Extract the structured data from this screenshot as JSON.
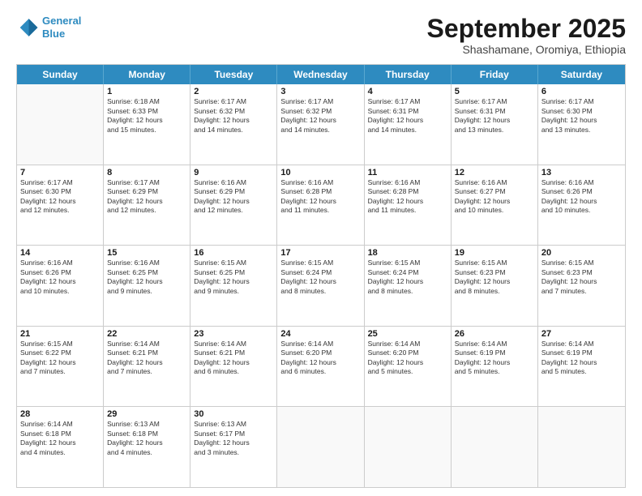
{
  "header": {
    "logo_line1": "General",
    "logo_line2": "Blue",
    "month_title": "September 2025",
    "subtitle": "Shashamane, Oromiya, Ethiopia"
  },
  "day_headers": [
    "Sunday",
    "Monday",
    "Tuesday",
    "Wednesday",
    "Thursday",
    "Friday",
    "Saturday"
  ],
  "weeks": [
    [
      {
        "num": "",
        "info": ""
      },
      {
        "num": "1",
        "info": "Sunrise: 6:18 AM\nSunset: 6:33 PM\nDaylight: 12 hours\nand 15 minutes."
      },
      {
        "num": "2",
        "info": "Sunrise: 6:17 AM\nSunset: 6:32 PM\nDaylight: 12 hours\nand 14 minutes."
      },
      {
        "num": "3",
        "info": "Sunrise: 6:17 AM\nSunset: 6:32 PM\nDaylight: 12 hours\nand 14 minutes."
      },
      {
        "num": "4",
        "info": "Sunrise: 6:17 AM\nSunset: 6:31 PM\nDaylight: 12 hours\nand 14 minutes."
      },
      {
        "num": "5",
        "info": "Sunrise: 6:17 AM\nSunset: 6:31 PM\nDaylight: 12 hours\nand 13 minutes."
      },
      {
        "num": "6",
        "info": "Sunrise: 6:17 AM\nSunset: 6:30 PM\nDaylight: 12 hours\nand 13 minutes."
      }
    ],
    [
      {
        "num": "7",
        "info": "Sunrise: 6:17 AM\nSunset: 6:30 PM\nDaylight: 12 hours\nand 12 minutes."
      },
      {
        "num": "8",
        "info": "Sunrise: 6:17 AM\nSunset: 6:29 PM\nDaylight: 12 hours\nand 12 minutes."
      },
      {
        "num": "9",
        "info": "Sunrise: 6:16 AM\nSunset: 6:29 PM\nDaylight: 12 hours\nand 12 minutes."
      },
      {
        "num": "10",
        "info": "Sunrise: 6:16 AM\nSunset: 6:28 PM\nDaylight: 12 hours\nand 11 minutes."
      },
      {
        "num": "11",
        "info": "Sunrise: 6:16 AM\nSunset: 6:28 PM\nDaylight: 12 hours\nand 11 minutes."
      },
      {
        "num": "12",
        "info": "Sunrise: 6:16 AM\nSunset: 6:27 PM\nDaylight: 12 hours\nand 10 minutes."
      },
      {
        "num": "13",
        "info": "Sunrise: 6:16 AM\nSunset: 6:26 PM\nDaylight: 12 hours\nand 10 minutes."
      }
    ],
    [
      {
        "num": "14",
        "info": "Sunrise: 6:16 AM\nSunset: 6:26 PM\nDaylight: 12 hours\nand 10 minutes."
      },
      {
        "num": "15",
        "info": "Sunrise: 6:16 AM\nSunset: 6:25 PM\nDaylight: 12 hours\nand 9 minutes."
      },
      {
        "num": "16",
        "info": "Sunrise: 6:15 AM\nSunset: 6:25 PM\nDaylight: 12 hours\nand 9 minutes."
      },
      {
        "num": "17",
        "info": "Sunrise: 6:15 AM\nSunset: 6:24 PM\nDaylight: 12 hours\nand 8 minutes."
      },
      {
        "num": "18",
        "info": "Sunrise: 6:15 AM\nSunset: 6:24 PM\nDaylight: 12 hours\nand 8 minutes."
      },
      {
        "num": "19",
        "info": "Sunrise: 6:15 AM\nSunset: 6:23 PM\nDaylight: 12 hours\nand 8 minutes."
      },
      {
        "num": "20",
        "info": "Sunrise: 6:15 AM\nSunset: 6:23 PM\nDaylight: 12 hours\nand 7 minutes."
      }
    ],
    [
      {
        "num": "21",
        "info": "Sunrise: 6:15 AM\nSunset: 6:22 PM\nDaylight: 12 hours\nand 7 minutes."
      },
      {
        "num": "22",
        "info": "Sunrise: 6:14 AM\nSunset: 6:21 PM\nDaylight: 12 hours\nand 7 minutes."
      },
      {
        "num": "23",
        "info": "Sunrise: 6:14 AM\nSunset: 6:21 PM\nDaylight: 12 hours\nand 6 minutes."
      },
      {
        "num": "24",
        "info": "Sunrise: 6:14 AM\nSunset: 6:20 PM\nDaylight: 12 hours\nand 6 minutes."
      },
      {
        "num": "25",
        "info": "Sunrise: 6:14 AM\nSunset: 6:20 PM\nDaylight: 12 hours\nand 5 minutes."
      },
      {
        "num": "26",
        "info": "Sunrise: 6:14 AM\nSunset: 6:19 PM\nDaylight: 12 hours\nand 5 minutes."
      },
      {
        "num": "27",
        "info": "Sunrise: 6:14 AM\nSunset: 6:19 PM\nDaylight: 12 hours\nand 5 minutes."
      }
    ],
    [
      {
        "num": "28",
        "info": "Sunrise: 6:14 AM\nSunset: 6:18 PM\nDaylight: 12 hours\nand 4 minutes."
      },
      {
        "num": "29",
        "info": "Sunrise: 6:13 AM\nSunset: 6:18 PM\nDaylight: 12 hours\nand 4 minutes."
      },
      {
        "num": "30",
        "info": "Sunrise: 6:13 AM\nSunset: 6:17 PM\nDaylight: 12 hours\nand 3 minutes."
      },
      {
        "num": "",
        "info": ""
      },
      {
        "num": "",
        "info": ""
      },
      {
        "num": "",
        "info": ""
      },
      {
        "num": "",
        "info": ""
      }
    ]
  ]
}
